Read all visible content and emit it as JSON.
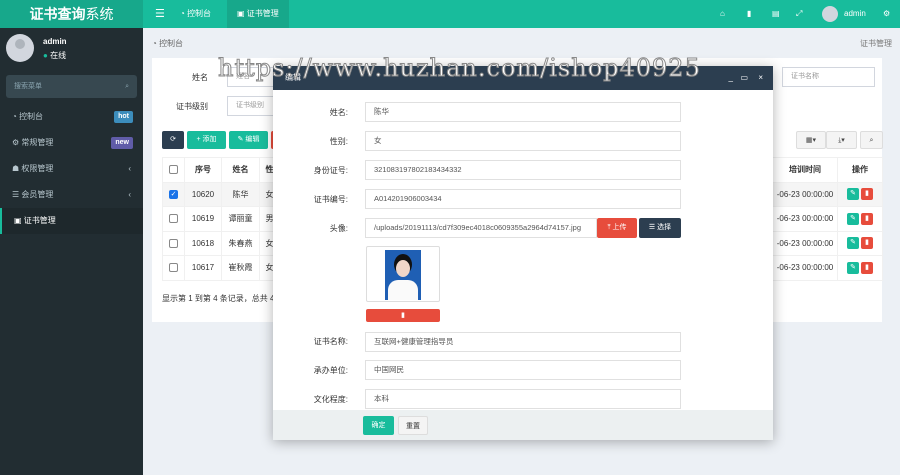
{
  "app": {
    "title_bold": "证书查询",
    "title_rest": "系统"
  },
  "topnav": {
    "menu_icon": "bars-icon",
    "items": [
      {
        "label": "控制台"
      },
      {
        "label": "证书管理"
      }
    ],
    "user": "admin"
  },
  "sidebar": {
    "user": "admin",
    "status": "在线",
    "search_placeholder": "搜索菜单",
    "items": [
      {
        "label": "控制台",
        "badge": "hot"
      },
      {
        "label": "常规管理",
        "badge": "new"
      },
      {
        "label": "权限管理"
      },
      {
        "label": "会员管理"
      },
      {
        "label": "证书管理"
      }
    ]
  },
  "breadcrumb": {
    "left": "控制台",
    "right": "证书管理"
  },
  "filters": {
    "name_label": "姓名",
    "name_placeholder": "姓名",
    "level_label": "证书级别",
    "level_placeholder": "证书级别",
    "cert_placeholder": "证书名称"
  },
  "toolbar": {
    "add": "添加",
    "edit": "编辑"
  },
  "table": {
    "headers": [
      "序号",
      "姓名",
      "性",
      "培训时间",
      "操作"
    ],
    "rows": [
      {
        "id": "10620",
        "name": "陈华",
        "g": "女",
        "time": "-06-23 00:00:00",
        "checked": true
      },
      {
        "id": "10619",
        "name": "谭丽童",
        "g": "男",
        "time": "-06-23 00:00:00"
      },
      {
        "id": "10618",
        "name": "朱春燕",
        "g": "女",
        "time": "-06-23 00:00:00"
      },
      {
        "id": "10617",
        "name": "崔秋霞",
        "g": "女",
        "time": "-06-23 00:00:00"
      }
    ],
    "footer": "显示第 1 到第 4 条记录，总共 4"
  },
  "modal": {
    "title": "编辑",
    "fields": [
      {
        "label": "姓名:",
        "value": "陈华"
      },
      {
        "label": "性别:",
        "value": "女"
      },
      {
        "label": "身份证号:",
        "value": "321083197802183434332"
      },
      {
        "label": "证书编号:",
        "value": "A014201906003434"
      },
      {
        "label": "头像:",
        "value": "/uploads/20191113/cd7f309ec4018c0609355a2964d74157.jpg"
      },
      {
        "label": "证书名称:",
        "value": "互联网+健康管理指导员"
      },
      {
        "label": "承办单位:",
        "value": "中国网民"
      },
      {
        "label": "文化程度:",
        "value": "本科"
      }
    ],
    "upload": "上传",
    "choose": "选择",
    "ok": "确定",
    "reset": "重置"
  },
  "watermark": "https://www.huzhan.com/ishop40925",
  "colors": {
    "primary": "#18bc9c",
    "danger": "#e74c3c",
    "dark": "#2c3e50"
  }
}
